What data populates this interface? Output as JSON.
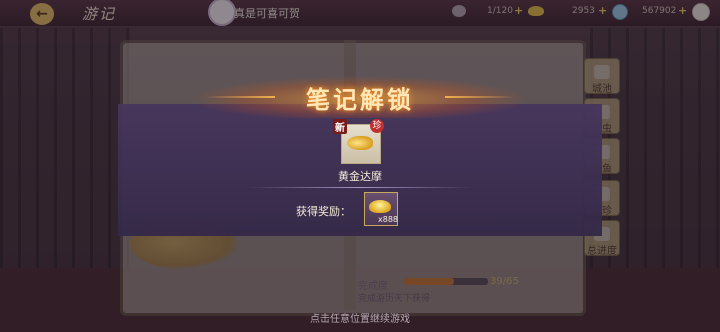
{
  "topbar": {
    "back_icon": "arrow-left-icon",
    "title": "游记",
    "chat_message": "真是可喜可贺",
    "item_count": "1/120",
    "gold": "2953",
    "gems": "567902"
  },
  "side_menu": [
    {
      "label": "城池",
      "icon": "city-icon"
    },
    {
      "label": "昆虫",
      "icon": "butterfly-icon"
    },
    {
      "label": "池鱼",
      "icon": "fish-icon"
    },
    {
      "label": "奇珍",
      "icon": "treasure-icon"
    },
    {
      "label": "总进度",
      "icon": "progress-icon"
    }
  ],
  "dialog": {
    "title": "笔记解锁",
    "new_tag": "新",
    "rare_tag": "珍",
    "item_name": "黄金达摩",
    "reward_label": "获得奖励：",
    "reward_quantity": "x888"
  },
  "progress": {
    "label": "完成度",
    "value": "39/65",
    "fraction": 0.6,
    "note": "完成游历天下获得"
  },
  "hint": "点击任意位置继续游戏",
  "colors": {
    "dialog_bg": "#46365c",
    "title_glow": "#ff9a2a",
    "accent_gold": "#e6c16a"
  }
}
